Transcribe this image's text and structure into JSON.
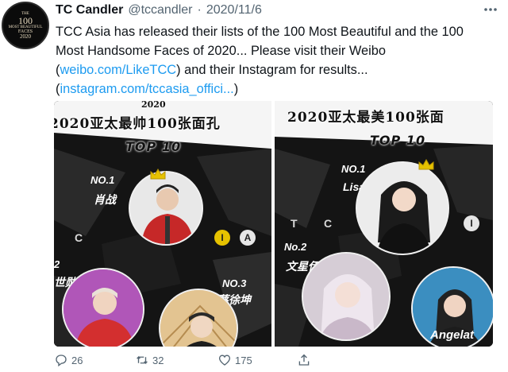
{
  "tweet": {
    "avatar_text": [
      "THE",
      "100",
      "MOST BEAUTIFUL",
      "FACES",
      "2020"
    ],
    "author_name": "TC Candler",
    "author_handle": "@tccandler",
    "separator": "·",
    "date": "2020/11/6",
    "more_icon": "more-horizontal-icon",
    "text_part1": "TCC Asia has released their lists of the 100 Most Beautiful and the 100 Most Handsome Faces of 2020... Please visit their Weibo (",
    "link_weibo": "weibo.com/LikeTCC",
    "text_part2": ") and their Instagram for results...  (",
    "link_instagram": "instagram.com/tccasia_offici...",
    "text_part3": ")"
  },
  "media": {
    "left": {
      "year": "2020",
      "headline": "2020亚太最帅100张面孔",
      "top_label": "TOP 10",
      "no1_rank": "NO.1",
      "no1_name": "肖战",
      "no2_rank": "2",
      "no2_name": "世勋",
      "no3_rank": "NO.3",
      "no3_name": "蔡徐坤",
      "letter_c": "C",
      "letter_i": "I",
      "letter_a": "A"
    },
    "right": {
      "headline": "2020亚太最美100张面",
      "top_label": "TOP 10",
      "no1_rank": "NO.1",
      "no1_name": "Lisa",
      "no2_rank": "No.2",
      "no2_name": "文星伊",
      "no3_name": "Angelat",
      "letter_t": "T",
      "letter_c": "C",
      "letter_i": "I"
    }
  },
  "actions": {
    "reply_count": "26",
    "retweet_count": "32",
    "like_count": "175",
    "icons": [
      "reply-icon",
      "retweet-icon",
      "like-icon",
      "share-icon"
    ]
  },
  "colors": {
    "link": "#1d9bf0",
    "secondary_text": "#536471",
    "primary_text": "#0f1419"
  }
}
